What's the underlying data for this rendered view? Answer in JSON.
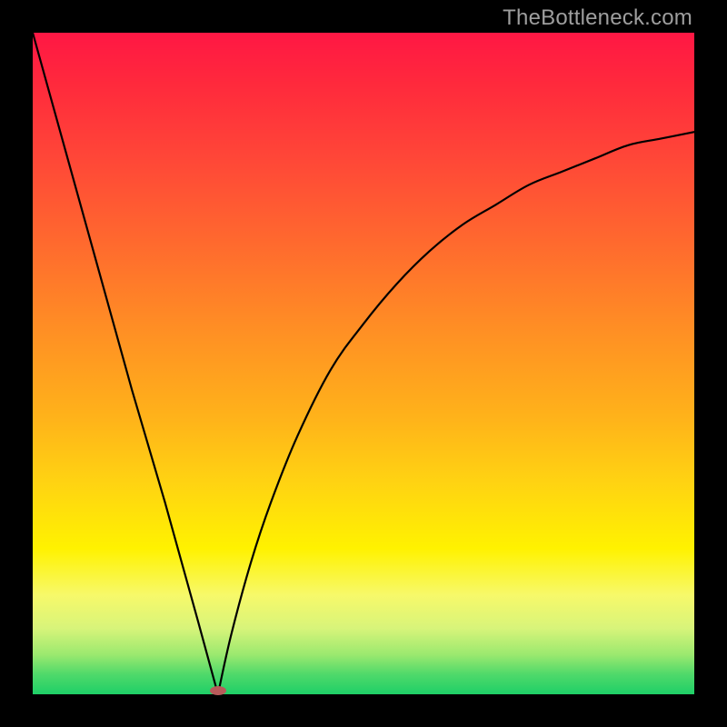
{
  "watermark": "TheBottleneck.com",
  "colors": {
    "frame": "#000000",
    "gradient_top": "#ff1744",
    "gradient_mid": "#ffd312",
    "gradient_bottom": "#1ecf67",
    "curve": "#000000",
    "marker": "#b85a5a"
  },
  "chart_data": {
    "type": "line",
    "title": "",
    "xlabel": "",
    "ylabel": "",
    "xlim": [
      0,
      100
    ],
    "ylim": [
      0,
      100
    ],
    "annotations": [
      {
        "text": "TheBottleneck.com",
        "position": "top-right"
      }
    ],
    "minimum": {
      "x": 28,
      "y": 0
    },
    "left_branch": {
      "description": "steep near-linear descent from top-left to minimum",
      "x": [
        0,
        5,
        10,
        15,
        20,
        25,
        28
      ],
      "y": [
        100,
        82,
        64,
        46,
        29,
        11,
        0
      ]
    },
    "right_branch": {
      "description": "concave-rising curve from minimum toward upper-right, asymptoting near y≈85",
      "x": [
        28,
        30,
        33,
        36,
        40,
        45,
        50,
        55,
        60,
        65,
        70,
        75,
        80,
        85,
        90,
        95,
        100
      ],
      "y": [
        0,
        9,
        20,
        29,
        39,
        49,
        56,
        62,
        67,
        71,
        74,
        77,
        79,
        81,
        83,
        84,
        85
      ]
    },
    "marker": {
      "x": 28,
      "y": 0.5,
      "color": "#b85a5a",
      "shape": "ellipse"
    }
  }
}
